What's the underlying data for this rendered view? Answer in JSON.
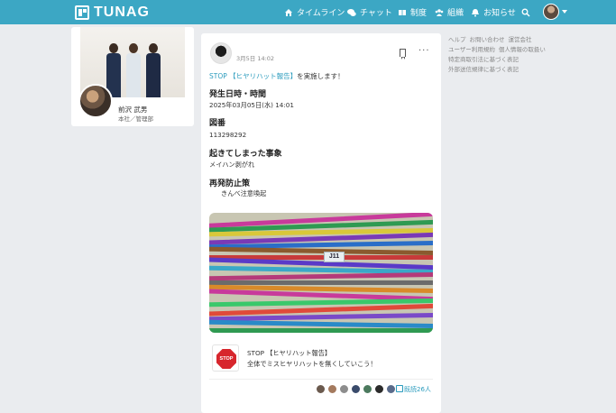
{
  "header": {
    "logo_text": "TUNAG",
    "nav": [
      {
        "label": "タイムライン",
        "icon": "home-icon"
      },
      {
        "label": "チャット",
        "icon": "chat-icon"
      },
      {
        "label": "制度",
        "icon": "book-icon"
      },
      {
        "label": "組織",
        "icon": "users-icon"
      },
      {
        "label": "お知らせ",
        "icon": "bell-icon"
      }
    ],
    "search_icon": "search-icon",
    "accent_color": "#3ca7c4"
  },
  "profile": {
    "name": "前沢 武男",
    "department": "本社／管理部"
  },
  "post": {
    "date": "3月5日 14:02",
    "lead_prefix": "STOP 【ヒヤリハット報告】",
    "lead_suffix": "を実施します！",
    "sections": [
      {
        "title": "発生日時・時間",
        "value": "2025年03月05日(水) 14:01"
      },
      {
        "title": "図番",
        "value": "113298292"
      },
      {
        "title": "起きてしまった事象",
        "value": "メイハン剥がれ"
      },
      {
        "title": "再発防止策",
        "value": "きんべ注意喚起"
      }
    ],
    "photo_tag": "J11",
    "stop_sign_text": "STOP",
    "template_title": "STOP 【ヒヤリハット報告】",
    "template_subtitle": "全体でミスヒヤリハットを無くしていこう！",
    "read_count": "既読26人"
  },
  "right_links": {
    "items": [
      "ヘルプ",
      "お問い合わせ",
      "運営会社",
      "ユーザー利用規約",
      "個人情報の取扱い",
      "特定商取引法に基づく表記",
      "外部送信規律に基づく表記"
    ]
  }
}
